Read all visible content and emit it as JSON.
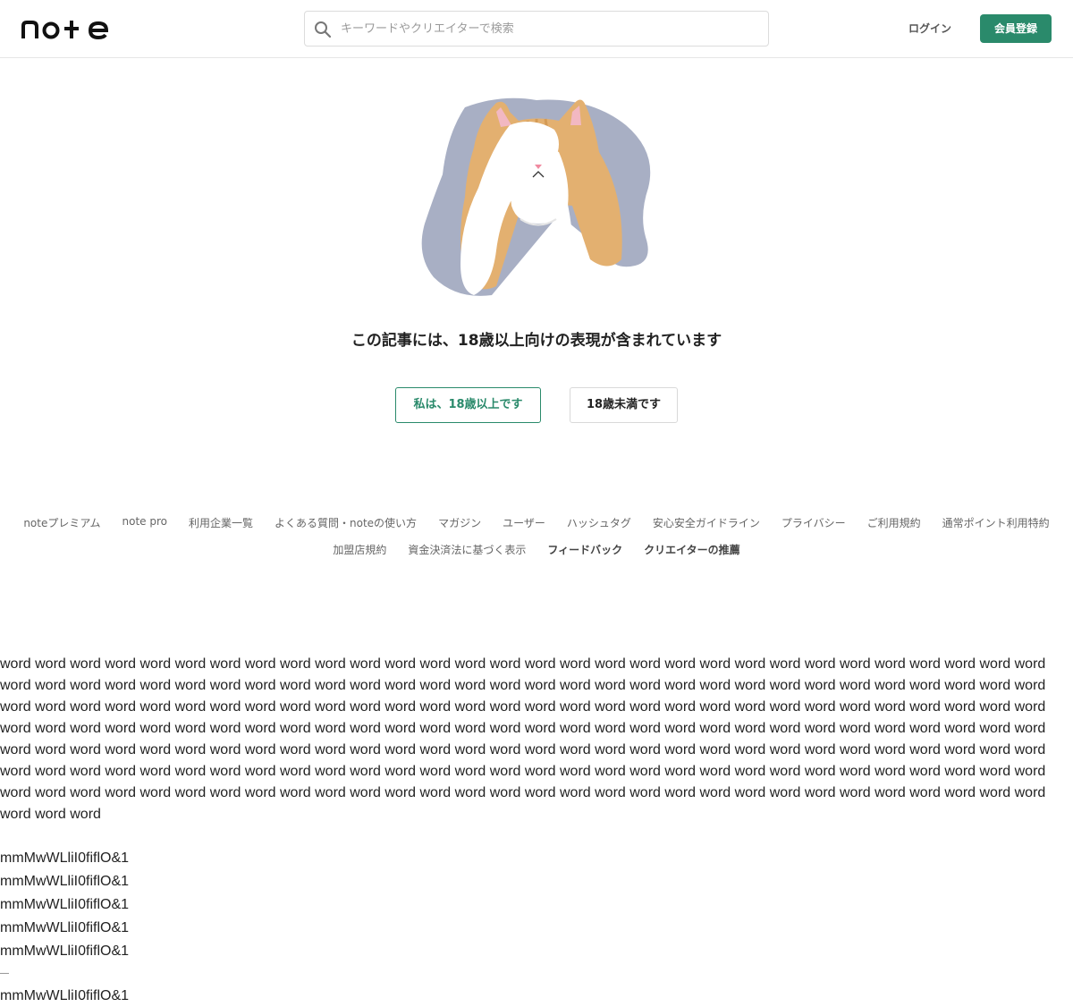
{
  "header": {
    "logo_text": "note",
    "search_placeholder": "キーワードやクリエイターで検索",
    "login_label": "ログイン",
    "signup_label": "会員登録"
  },
  "notice": {
    "message": "この記事には、18歳以上向けの表現が含まれています",
    "adult_button": "私は、18歳以上です",
    "minor_button": "18歳未満です"
  },
  "footer": {
    "row1": [
      "noteプレミアム",
      "note pro",
      "利用企業一覧",
      "よくある質問・noteの使い方",
      "マガジン",
      "ユーザー",
      "ハッシュタグ",
      "安心安全ガイドライン",
      "プライバシー",
      "ご利用規約",
      "通常ポイント利用特約"
    ],
    "row2": [
      "加盟店規約",
      "資金決済法に基づく表示"
    ],
    "row2_bold": [
      "フィードバック",
      "クリエイターの推薦"
    ]
  },
  "test_text": {
    "word_paragraph": "word word word word word word word word word word word word word word word word word word word word word word word word word word word word word word word word word word word word word word word word word word word word word word word word word word word word word word word word word word word word word word word word word word word word word word word word word word word word word word word word word word word word word word word word word word word word word word word word word word word word word word word word word word word word word word word word word word word word word word word word word word word word word word word word word word word word word word word word word word word word word word word word word word word word word word word word word word word word word word word word word word word word word word word word word word word word word word word word word word word word word word word word word word word word word word word word word word word word word word word word word word word word word word word word word word word word word",
    "probe_lines": [
      "mmMwWLliI0fiflO&1",
      "mmMwWLliI0fiflO&1",
      "mmMwWLliI0fiflO&1",
      "mmMwWLliI0fiflO&1",
      "mmMwWLliI0fiflO&1"
    ],
    "separator": "—",
    "final_probe": "mmMwWLliI0fiflO&1"
  }
}
